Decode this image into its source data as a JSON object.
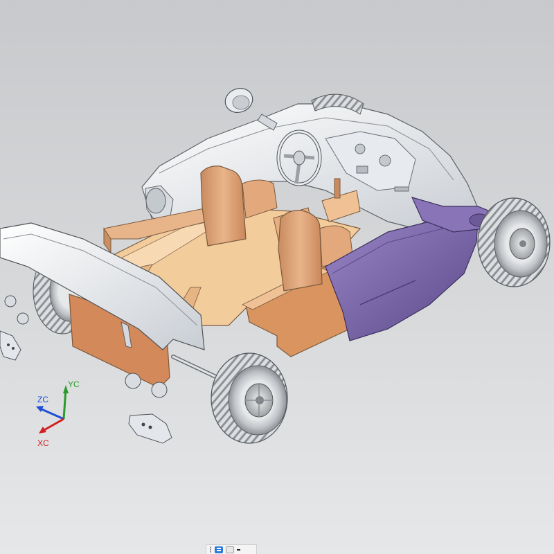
{
  "window": {
    "type": "CAD assembly viewport",
    "background_colors": [
      "#c7c9cc",
      "#e6e7e9"
    ]
  },
  "model": {
    "part_colors": {
      "body": "#eef1f4",
      "floor": "#f2c99a",
      "seats": "#e0a77c",
      "door": "#7a63a8",
      "tires": "#c9cccf",
      "hub": "#9fa3a7"
    }
  },
  "triad": {
    "x_label": "XC",
    "y_label": "YC",
    "z_label": "ZC",
    "x_color": "#d21f1f",
    "y_color": "#2a9a2a",
    "z_color": "#1f4fd2"
  },
  "taskbar": {
    "items": [
      {
        "icon": "grip-dots-icon"
      },
      {
        "icon": "app-window-icon"
      },
      {
        "icon": "app-secondary-icon"
      },
      {
        "icon": "minimize-icon"
      }
    ]
  }
}
